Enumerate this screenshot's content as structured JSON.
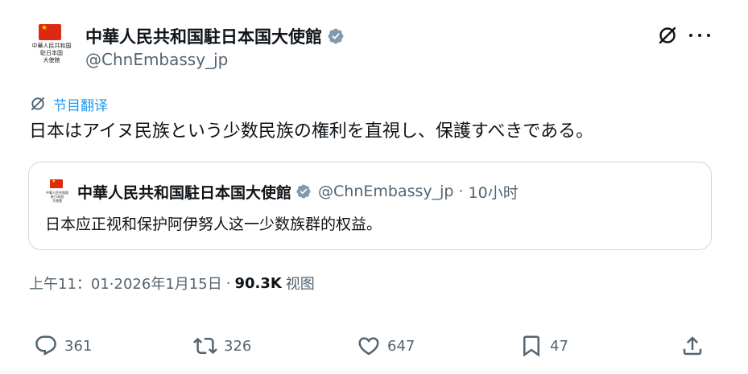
{
  "author": {
    "display_name": "中華人民共和国駐日本国大使館",
    "handle": "@ChnEmbassy_jp",
    "avatar_caption": "中華人民共和国\n駐日本国\n大使館",
    "verified": true
  },
  "translate": {
    "label": "节目翻译",
    "icon": "grok-icon"
  },
  "tweet": {
    "text": "日本はアイヌ民族という少数民族の権利を直視し、保護すべきである。"
  },
  "quote": {
    "display_name": "中華人民共和国駐日本国大使館",
    "handle": "@ChnEmbassy_jp",
    "dot": "·",
    "time": "10小时",
    "text": "日本应正视和保护阿伊努人这一少数族群的权益。",
    "avatar_caption": "中華人民共和国\n駐日本国\n大使館"
  },
  "meta": {
    "timestamp": "上午11：01·2026年1月15日",
    "separator": "·",
    "views_count": "90.3K",
    "views_label": "视图"
  },
  "actions": {
    "reply": {
      "icon": "reply-icon",
      "count": "361"
    },
    "retweet": {
      "icon": "retweet-icon",
      "count": "326"
    },
    "like": {
      "icon": "heart-icon",
      "count": "647"
    },
    "bookmark": {
      "icon": "bookmark-icon",
      "count": "47"
    },
    "share": {
      "icon": "share-icon"
    }
  },
  "colors": {
    "accent": "#1d9bf0",
    "text": "#0f1419",
    "secondary": "#536471",
    "border": "#cfd9de",
    "flag": "#de2910"
  }
}
